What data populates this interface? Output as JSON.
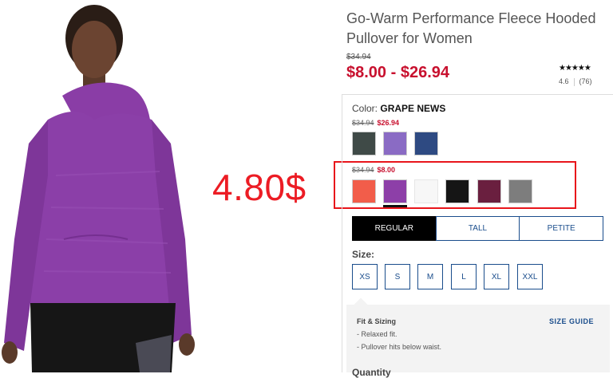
{
  "product": {
    "title": "Go-Warm Performance Fleece Hooded Pullover for Women",
    "original_price": "$34.94",
    "price_range": "$8.00 - $26.94",
    "stars": "★★★★★",
    "rating": "4.6",
    "review_count": "(76)"
  },
  "color": {
    "label": "Color:",
    "selected_name": "GRAPE NEWS",
    "groups": [
      {
        "was": "$34.94",
        "now": "$26.94",
        "swatches": [
          {
            "name": "charcoal",
            "color": "#3f4a47"
          },
          {
            "name": "lavender",
            "color": "#8a6bc4"
          },
          {
            "name": "navy",
            "color": "#2e4a82"
          }
        ]
      },
      {
        "was": "$34.94",
        "now": "$8.00",
        "swatches": [
          {
            "name": "coral",
            "color": "#f25d4a"
          },
          {
            "name": "grape-news",
            "color": "#8d3fa8",
            "selected": true
          },
          {
            "name": "white",
            "color": "#f7f7f7"
          },
          {
            "name": "black",
            "color": "#151515"
          },
          {
            "name": "plum",
            "color": "#6a1f3f"
          },
          {
            "name": "heather-gray",
            "color": "#7d7d7d"
          }
        ]
      }
    ]
  },
  "fit_tabs": [
    "REGULAR",
    "TALL",
    "PETITE"
  ],
  "active_fit": "REGULAR",
  "size": {
    "label": "Size:",
    "options": [
      "XS",
      "S",
      "M",
      "L",
      "XL",
      "XXL"
    ]
  },
  "fit_sizing": {
    "title": "Fit & Sizing",
    "guide_link": "SIZE GUIDE",
    "items": [
      "- Relaxed fit.",
      "- Pullover hits below waist."
    ]
  },
  "quantity_label": "Quantity",
  "annotation": {
    "text": "4.80$",
    "color": "#ec1c24"
  },
  "colors": {
    "sale_red": "#c8102e",
    "link_blue": "#1a4d8c"
  }
}
